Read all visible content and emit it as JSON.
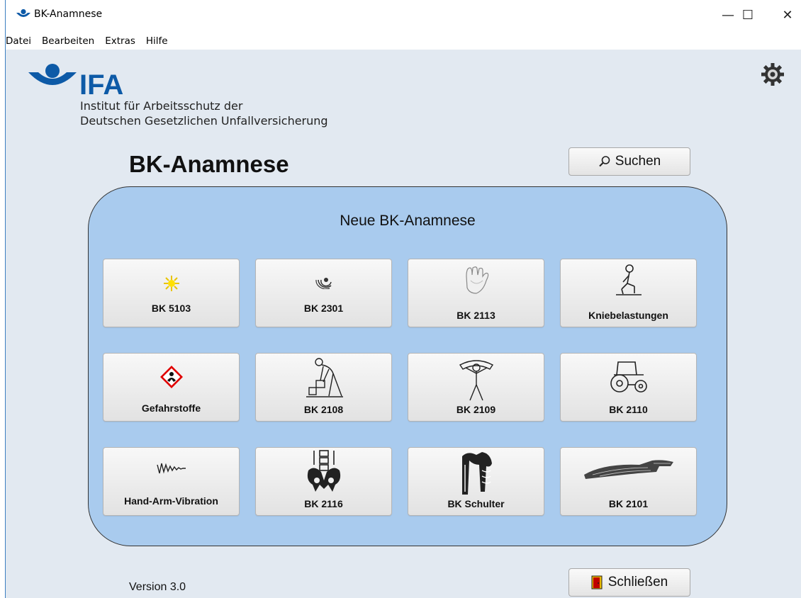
{
  "window": {
    "title": "BK-Anamnese",
    "controls": {
      "minimize": "—",
      "maximize": "☐",
      "close": "✕"
    }
  },
  "menu": [
    "Datei",
    "Bearbeiten",
    "Extras",
    "Hilfe"
  ],
  "brand": {
    "logo_text": "IFA",
    "line1": "Institut für Arbeitsschutz der",
    "line2": "Deutschen Gesetzlichen Unfallversicherung",
    "color": "#0d5aa7"
  },
  "header": {
    "title": "BK-Anamnese",
    "search_label": "Suchen",
    "search_icon": "magnifier-icon",
    "settings_icon": "gear-icon"
  },
  "panel": {
    "title": "Neue BK-Anamnese",
    "background": "#a9cbee",
    "tiles": [
      {
        "label": "BK 5103",
        "icon": "sun-icon"
      },
      {
        "label": "BK 2301",
        "icon": "noise-ear-icon"
      },
      {
        "label": "BK 2113",
        "icon": "hand-icon"
      },
      {
        "label": "Kniebelastungen",
        "icon": "kneeling-person-icon"
      },
      {
        "label": "Gefahrstoffe",
        "icon": "hazard-diamond-icon"
      },
      {
        "label": "BK 2108",
        "icon": "lifting-person-icon"
      },
      {
        "label": "BK 2109",
        "icon": "shoulder-load-person-icon"
      },
      {
        "label": "BK 2110",
        "icon": "tractor-icon"
      },
      {
        "label": "Hand-Arm-Vibration",
        "icon": "vibration-wave-icon"
      },
      {
        "label": "BK 2116",
        "icon": "pelvis-icon"
      },
      {
        "label": "BK Schulter",
        "icon": "shoulder-bone-icon"
      },
      {
        "label": "BK 2101",
        "icon": "forearm-muscle-icon"
      }
    ]
  },
  "footer": {
    "version": "Version 3.0",
    "close_label": "Schließen",
    "close_icon": "exit-door-icon"
  }
}
